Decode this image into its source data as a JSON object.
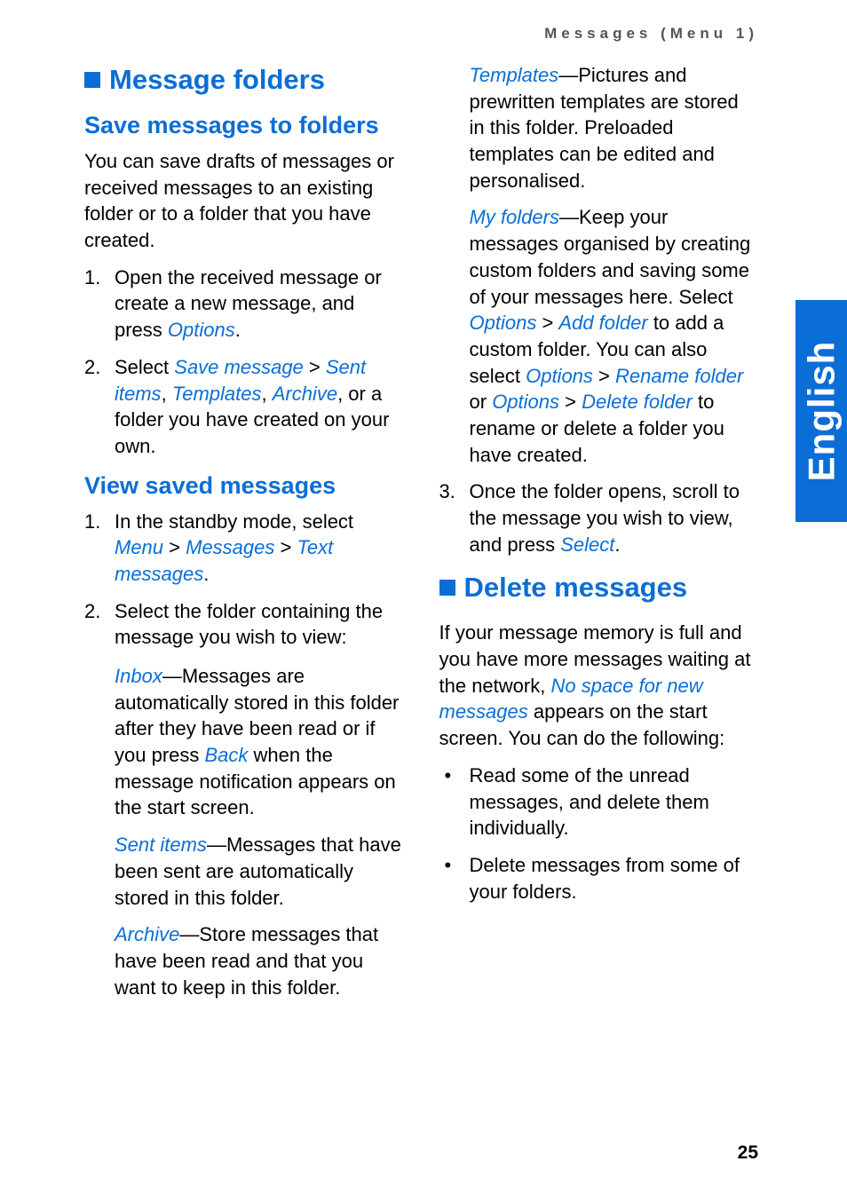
{
  "header": "Messages (Menu 1)",
  "sideTab": "English",
  "pageNumber": "25",
  "h1a": "Message folders",
  "h2a": "Save messages to folders",
  "p1": "You can save drafts of messages or received messages to an existing folder or to a folder that you have created.",
  "s1_li1_a": "Open the received message or create a new message, and press ",
  "s1_li1_b": "Options",
  "s1_li1_c": ".",
  "s1_li2_a": "Select ",
  "s1_li2_b": "Save message",
  "s1_li2_c": " > ",
  "s1_li2_d": "Sent items",
  "s1_li2_e": ", ",
  "s1_li2_f": "Templates",
  "s1_li2_g": ", ",
  "s1_li2_h": "Archive",
  "s1_li2_i": ", or a folder you have created on your own.",
  "h2b": "View saved messages",
  "v_li1_a": "In the standby mode, select ",
  "v_li1_b": "Menu",
  "v_li1_c": " > ",
  "v_li1_d": "Messages",
  "v_li1_e": " > ",
  "v_li1_f": "Text messages",
  "v_li1_g": ".",
  "v_li2": "Select the folder containing the message you wish to view:",
  "inbox_a": "Inbox",
  "inbox_b": "—Messages are automatically stored in this folder after they have been read or if you press ",
  "inbox_c": "Back",
  "inbox_d": " when the message notification appears on the start screen.",
  "sent_a": "Sent items",
  "sent_b": "—Messages that have been sent are automatically stored in this folder.",
  "arch_a": "Archive",
  "arch_b": "—Store messages that have been read and that you want to keep in this folder.",
  "tmpl_a": "Templates",
  "tmpl_b": "—Pictures and prewritten templates are stored in this folder. Preloaded templates can be edited and personalised.",
  "myf_a": "My folders",
  "myf_b": "—Keep your messages organised by creating custom folders and saving some of your messages here. Select ",
  "myf_c": "Options",
  "myf_d": " > ",
  "myf_e": "Add folder",
  "myf_f": " to add a custom folder. You can also select ",
  "myf_g": "Options",
  "myf_h": " > ",
  "myf_i": "Rename folder",
  "myf_j": " or ",
  "myf_k": "Options",
  "myf_l": " > ",
  "myf_m": "Delete folder",
  "myf_n": " to rename or delete a folder you have created.",
  "v_li3_a": "Once the folder opens, scroll to the message you wish to view, and press ",
  "v_li3_b": "Select",
  "v_li3_c": ".",
  "h1b": "Delete messages",
  "del_p_a": "If your message memory is full and you have more messages waiting at the network, ",
  "del_p_b": "No space for new messages",
  "del_p_c": " appears on the start screen. You can do the following:",
  "del_b1": "Read some of the unread messages, and delete them individually.",
  "del_b2": "Delete messages from some of your folders."
}
